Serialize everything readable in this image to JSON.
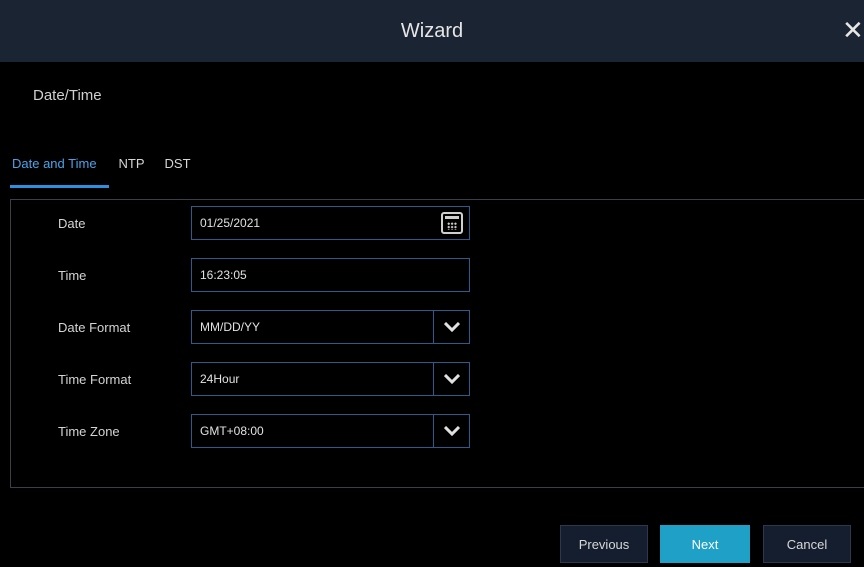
{
  "window": {
    "title": "Wizard",
    "close_glyph": "✕"
  },
  "section": {
    "title": "Date/Time"
  },
  "tabs": [
    {
      "label": "Date and Time",
      "active": true
    },
    {
      "label": "NTP",
      "active": false
    },
    {
      "label": "DST",
      "active": false
    }
  ],
  "form": {
    "date": {
      "label": "Date",
      "value": "01/25/2021",
      "icon": "calendar-icon"
    },
    "time": {
      "label": "Time",
      "value": "16:23:05"
    },
    "date_format": {
      "label": "Date Format",
      "value": "MM/DD/YY",
      "icon": "chevron-down-icon"
    },
    "time_format": {
      "label": "Time Format",
      "value": "24Hour",
      "icon": "chevron-down-icon"
    },
    "time_zone": {
      "label": "Time Zone",
      "value": "GMT+08:00",
      "icon": "chevron-down-icon"
    }
  },
  "buttons": {
    "previous": "Previous",
    "next": "Next",
    "cancel": "Cancel"
  },
  "colors": {
    "titlebar": "#1b2433",
    "accent_tab": "#4aa3e8",
    "field_border": "#2e5a8c",
    "primary_button": "#1ea0c7",
    "secondary_button": "#141e2e"
  }
}
